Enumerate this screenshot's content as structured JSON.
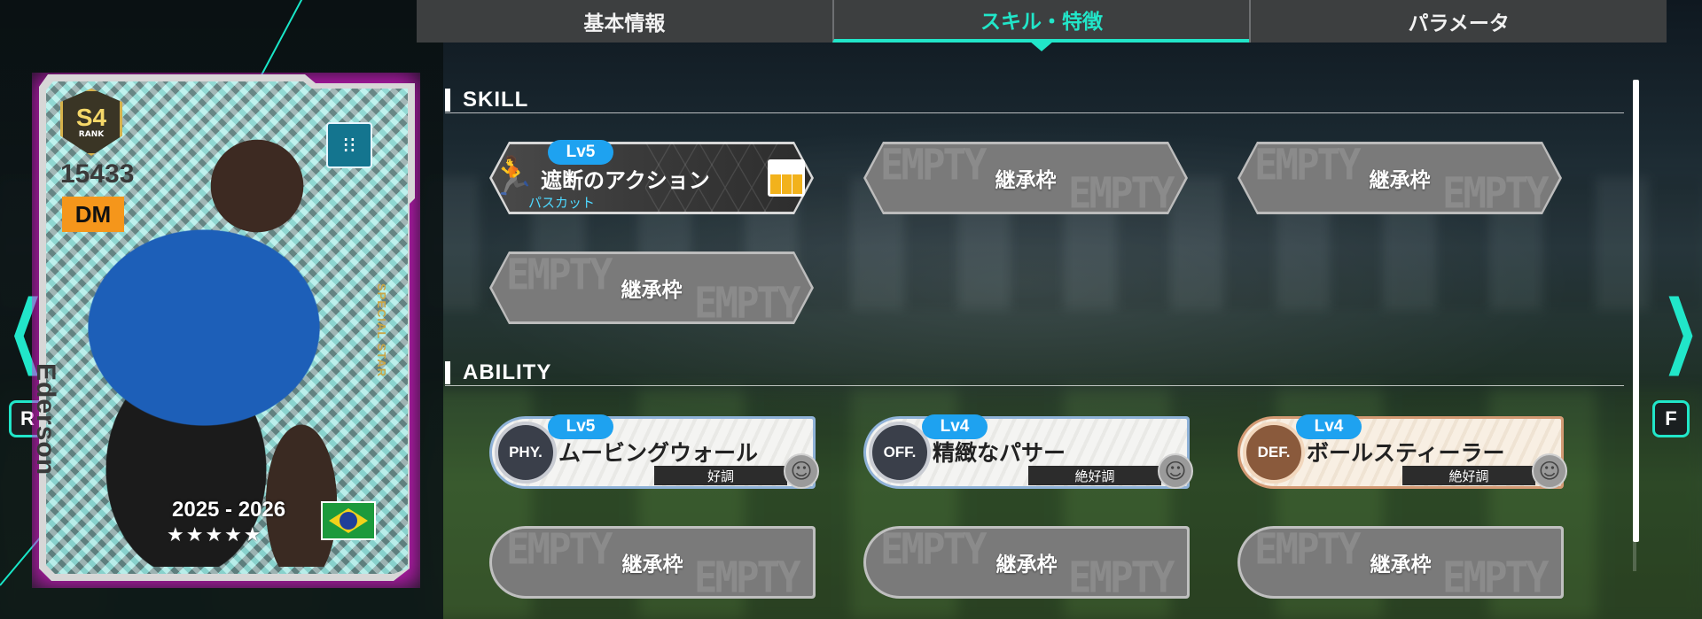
{
  "tabs": [
    {
      "label": "基本情報",
      "active": false
    },
    {
      "label": "スキル・特徴",
      "active": true
    },
    {
      "label": "パラメータ",
      "active": false
    }
  ],
  "sections": {
    "skill": "SKILL",
    "ability": "ABILITY"
  },
  "empty_watermark": "EMPTY",
  "skills": [
    {
      "level": "Lv5",
      "name": "遮断のアクション",
      "sub": "パスカット",
      "icon": "running-player-icon",
      "field_icon": "field-zone-icon"
    },
    {
      "empty_label": "継承枠"
    },
    {
      "empty_label": "継承枠"
    },
    {
      "empty_label": "継承枠"
    }
  ],
  "abilities": [
    {
      "level": "Lv5",
      "category": "PHY.",
      "name": "ムービングウォール",
      "condition": "好調",
      "icon": "smiley-icon"
    },
    {
      "level": "Lv4",
      "category": "OFF.",
      "name": "精緻なパサー",
      "condition": "絶好調",
      "icon": "smiley-icon"
    },
    {
      "level": "Lv4",
      "category": "DEF.",
      "name": "ボールスティーラー",
      "condition": "絶好調",
      "icon": "smiley-icon"
    },
    {
      "empty_label": "継承枠"
    },
    {
      "empty_label": "継承枠"
    },
    {
      "empty_label": "継承枠"
    }
  ],
  "nav": {
    "left_key": "R",
    "right_key": "F",
    "left_arrow": "❮",
    "right_arrow": "❯"
  },
  "card": {
    "rank": "S4",
    "rank_label": "RANK",
    "rating": "15433",
    "position": "DM",
    "player_name": "Ederson",
    "card_type": "SPECIAL STAR",
    "season": "2025 - 2026",
    "stars": "★★★★★",
    "nationality_flag": "brazil-flag-icon",
    "formation_icon": "formation-icon",
    "glow_color": "#e81ad8"
  },
  "colors": {
    "accent": "#21e6c9",
    "level_badge": "#1ea2f0",
    "tab_bar": "#3d3f40"
  }
}
